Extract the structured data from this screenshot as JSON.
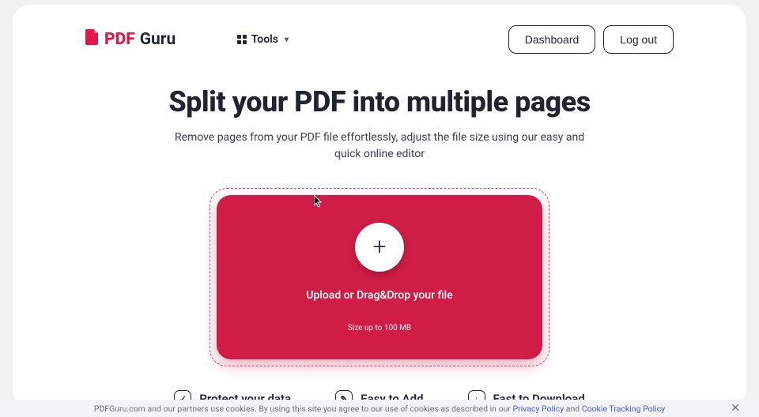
{
  "brand": {
    "pdf": "PDF",
    "guru": "Guru"
  },
  "nav": {
    "tools_label": "Tools",
    "dashboard": "Dashboard",
    "logout": "Log out"
  },
  "hero": {
    "title": "Split your PDF into multiple pages",
    "subtitle": "Remove pages from your PDF file effortlessly, adjust the file size using our easy and quick online editor"
  },
  "upload": {
    "label": "Upload or Drag&Drop your file",
    "size_hint": "Size up to 100 MB"
  },
  "features": {
    "a": "Protect your data",
    "b": "Easy to Add",
    "c": "Fast to Download"
  },
  "cookie": {
    "pre": "PDFGuru.com and our partners use cookies. By using this site you agree to our use of cookies as described in our ",
    "privacy": "Privacy Policy",
    "and": " and ",
    "tracking": "Cookie Tracking Policy"
  }
}
